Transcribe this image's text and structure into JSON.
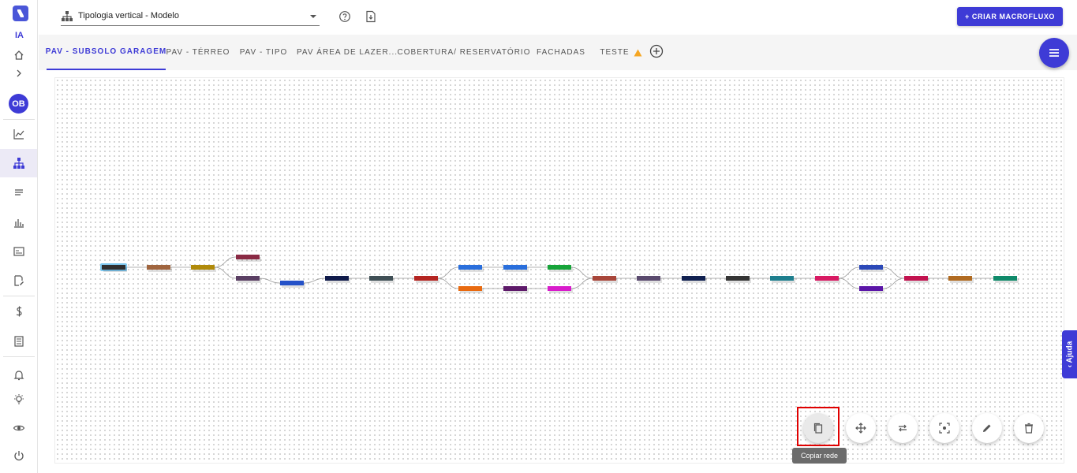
{
  "sidebar": {
    "ia_label": "IA",
    "avatar_initials": "OB",
    "icons": [
      "logo-icon",
      "home-icon",
      "chevron-right-icon",
      "avatar",
      "chart-line-icon",
      "hierarchy-icon",
      "lines-icon",
      "bar-chart-icon",
      "card-icon",
      "document-edit-icon",
      "dollar-icon",
      "list-icon",
      "bell-icon",
      "lightbulb-icon",
      "eye-icon",
      "power-icon"
    ],
    "active_item": "hierarchy-icon"
  },
  "header": {
    "tipologia_select": "Tipologia vertical - Modelo",
    "criar_button": "+ CRIAR MACROFLUXO"
  },
  "tabs": [
    {
      "label": "PAV - SUBSOLO GARAGEM",
      "active": true
    },
    {
      "label": "PAV - TÉRREO"
    },
    {
      "label": "PAV - TIPO"
    },
    {
      "label": "PAV ÁREA DE LAZER..."
    },
    {
      "label": "COBERTURA/ RESERVATÓRIO"
    },
    {
      "label": "FACHADAS"
    },
    {
      "label": "TESTE",
      "warning": true
    }
  ],
  "colors": {
    "accent": "#3e3bd6",
    "highlight": "#e00000",
    "warning": "#f5a623"
  },
  "flow_nodes": [
    {
      "color": "#2f2f2f",
      "selected": true
    },
    {
      "color": "#a0653f"
    },
    {
      "color": "#b08a0a"
    },
    {
      "color": "#8a2a44"
    },
    {
      "color": "#5a3f63"
    },
    {
      "color": "#2451c8"
    },
    {
      "color": "#0f1a4a"
    },
    {
      "color": "#3f4f55"
    },
    {
      "color": "#b42421"
    },
    {
      "color": "#2a6fdc"
    },
    {
      "color": "#e86a10"
    },
    {
      "color": "#2a6fdc"
    },
    {
      "color": "#5e1a6a"
    },
    {
      "color": "#17a43a"
    },
    {
      "color": "#d81ccb"
    },
    {
      "color": "#a8463a"
    },
    {
      "color": "#5a4a6e"
    },
    {
      "color": "#102050"
    },
    {
      "color": "#353535"
    },
    {
      "color": "#1e7f8e"
    },
    {
      "color": "#d81a63"
    },
    {
      "color": "#2c49b8"
    },
    {
      "color": "#5b16a8"
    },
    {
      "color": "#c2124f"
    },
    {
      "color": "#b06a20"
    },
    {
      "color": "#0f8a6a"
    }
  ],
  "ajuda_label": "Ajuda",
  "actions": [
    {
      "name": "copy-network-button",
      "icon": "copy-icon"
    },
    {
      "name": "move-button",
      "icon": "move-icon"
    },
    {
      "name": "swap-button",
      "icon": "swap-icon"
    },
    {
      "name": "fit-view-button",
      "icon": "focus-icon"
    },
    {
      "name": "edit-button",
      "icon": "pencil-icon"
    },
    {
      "name": "delete-button",
      "icon": "trash-icon"
    }
  ],
  "tooltip": "Copiar rede"
}
